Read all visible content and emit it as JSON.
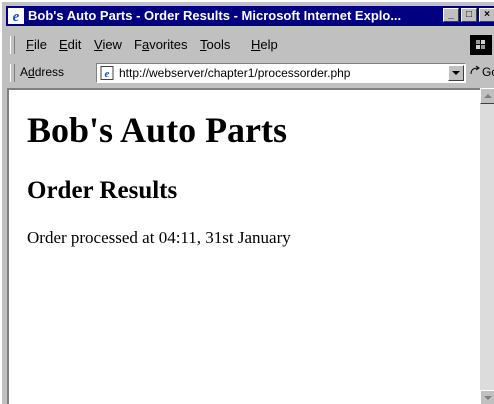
{
  "window": {
    "title": "Bob's Auto Parts - Order Results - Microsoft Internet Explo...",
    "controls": {
      "minimize": "_",
      "maximize": "□",
      "close": "×"
    }
  },
  "menubar": {
    "items": [
      {
        "pre": "",
        "key": "F",
        "post": "ile"
      },
      {
        "pre": "",
        "key": "E",
        "post": "dit"
      },
      {
        "pre": "",
        "key": "V",
        "post": "iew"
      },
      {
        "pre": "F",
        "key": "a",
        "post": "vorites"
      },
      {
        "pre": "",
        "key": "T",
        "post": "ools"
      },
      {
        "pre": "",
        "key": "H",
        "post": "elp"
      }
    ]
  },
  "addressbar": {
    "label_pre": "A",
    "label_key": "d",
    "label_post": "dress",
    "url": "http://webserver/chapter1/processorder.php",
    "go_label": "Go"
  },
  "page": {
    "heading": "Bob's Auto Parts",
    "subheading": "Order Results",
    "message": "Order processed at 04:11, 31st January"
  },
  "icons": {
    "browser": "ie-logo-icon",
    "page": "page-icon",
    "go": "go-arrow-icon",
    "throbber": "windows-logo-icon",
    "scroll_up": "scroll-up-arrow-icon",
    "scroll_down": "scroll-down-arrow-icon"
  }
}
